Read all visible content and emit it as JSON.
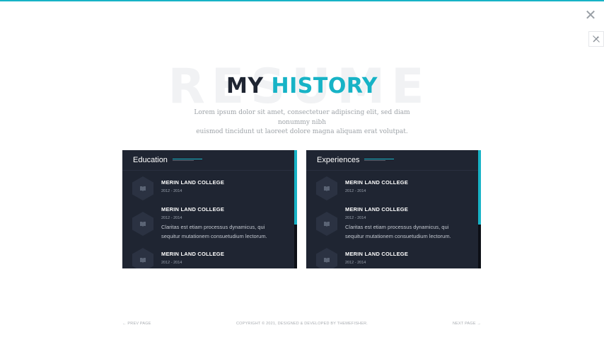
{
  "hero": {
    "bg_word": "RESUME",
    "title_part1": "MY",
    "title_part2": "HISTORY",
    "subtitle_line1": "Lorem ipsum dolor sit amet, consectetuer adipiscing elit, sed diam nonummy nibh",
    "subtitle_line2": "euismod tincidunt ut laoreet dolore magna aliquam erat volutpat."
  },
  "controls": {
    "close_glyph": "✕",
    "close_icon": "close-icon",
    "tool_icon": "magic-wand-off-icon"
  },
  "education": {
    "title": "Education",
    "items": [
      {
        "school": "MERIN LAND COLLEGE",
        "years": "2012 - 2014",
        "desc_line1": "",
        "desc_line2": ""
      },
      {
        "school": "MERIN LAND COLLEGE",
        "years": "2012 - 2014",
        "desc_line1": "Claritas est etiam processus dynamicus, qui",
        "desc_line2": "sequitur mutationem consuetudium lectorum."
      },
      {
        "school": "MERIN LAND COLLEGE",
        "years": "2012 - 2014",
        "desc_line1": "",
        "desc_line2": ""
      }
    ]
  },
  "experiences": {
    "title": "Experiences",
    "items": [
      {
        "school": "MERIN LAND COLLEGE",
        "years": "2012 - 2014",
        "desc_line1": "",
        "desc_line2": ""
      },
      {
        "school": "MERIN LAND COLLEGE",
        "years": "2012 - 2014",
        "desc_line1": "Claritas est etiam processus dynamicus, qui",
        "desc_line2": "sequitur mutationem consuetudium lectorum."
      },
      {
        "school": "MERIN LAND COLLEGE",
        "years": "2012 - 2014",
        "desc_line1": "",
        "desc_line2": ""
      }
    ]
  },
  "footer": {
    "prev": "← PREV PAGE",
    "copyright": "COPYRIGHT © 2021, DESIGNED & DEVELOPED BY THEMEFISHER.",
    "next": "NEXT PAGE →"
  },
  "colors": {
    "accent": "#17b3c6",
    "card_bg": "#1f2532",
    "dark_text": "#1f2532"
  }
}
